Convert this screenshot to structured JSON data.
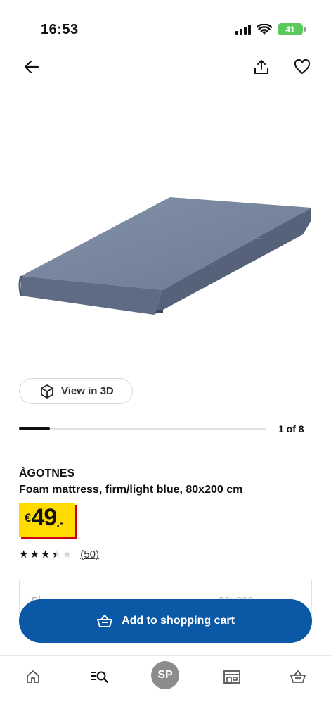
{
  "status_bar": {
    "time": "16:53",
    "battery": "41"
  },
  "top_nav": {
    "back_icon": "arrow-left-icon",
    "share_icon": "share-icon",
    "favorite_icon": "heart-icon"
  },
  "gallery": {
    "view_3d_label": "View in 3D",
    "pager_text": "1 of 8",
    "pager_progress": 0.125
  },
  "product": {
    "name": "ÅGOTNES",
    "description": "Foam mattress, firm/light blue, 80x200 cm",
    "price": {
      "currency": "€",
      "value": "49",
      "suffix": ".-"
    },
    "rating": {
      "stars": 3.5,
      "max": 5,
      "count_label": "(50)"
    },
    "size_label": "Si",
    "size_value": "80x200"
  },
  "cart_button": {
    "label": "Add to shopping cart"
  },
  "bottom_nav": {
    "home_icon": "home-icon",
    "search_icon": "search-menu-icon",
    "profile_initials": "SP",
    "store_icon": "store-icon",
    "cart_icon": "basket-icon"
  },
  "colors": {
    "accent_blue": "#0b58a6",
    "price_yellow": "#ffdb00",
    "price_red": "#cc0008",
    "battery_green": "#5cc95c",
    "mattress_blue": "#6f7c96"
  }
}
